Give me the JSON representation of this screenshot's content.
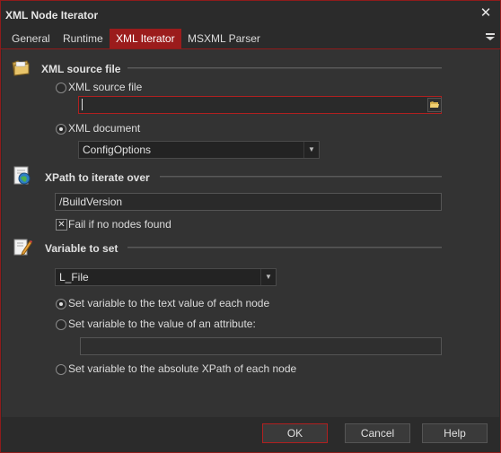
{
  "window": {
    "title": "XML Node Iterator"
  },
  "tabs": [
    {
      "label": "General"
    },
    {
      "label": "Runtime"
    },
    {
      "label": "XML Iterator"
    },
    {
      "label": "MSXML Parser"
    }
  ],
  "active_tab": "XML Iterator",
  "xml_source": {
    "section_title": "XML source file",
    "option_file_label": "XML source file",
    "file_path_value": "",
    "option_document_label": "XML document",
    "document_selected": "ConfigOptions",
    "selected_option": "XML document"
  },
  "xpath": {
    "section_title": "XPath to iterate over",
    "value": "/BuildVersion",
    "fail_label": "Fail if no nodes found",
    "fail_checked": true
  },
  "variable": {
    "section_title": "Variable to set",
    "selected": "L_File",
    "option_text_label": "Set variable to the text value of each node",
    "option_attr_label": "Set variable to the value of an attribute:",
    "attribute_value": "",
    "option_xpath_label": "Set variable to the absolute XPath of each node",
    "selected_option": "Set variable to the text value of each node"
  },
  "buttons": {
    "ok": "OK",
    "cancel": "Cancel",
    "help": "Help"
  },
  "icons": {
    "close": "close-icon",
    "tab_menu": "menu-icon",
    "folder": "folder-icon",
    "xpath": "document-globe-icon",
    "variable": "pencil-icon",
    "browse": "open-folder-icon"
  }
}
